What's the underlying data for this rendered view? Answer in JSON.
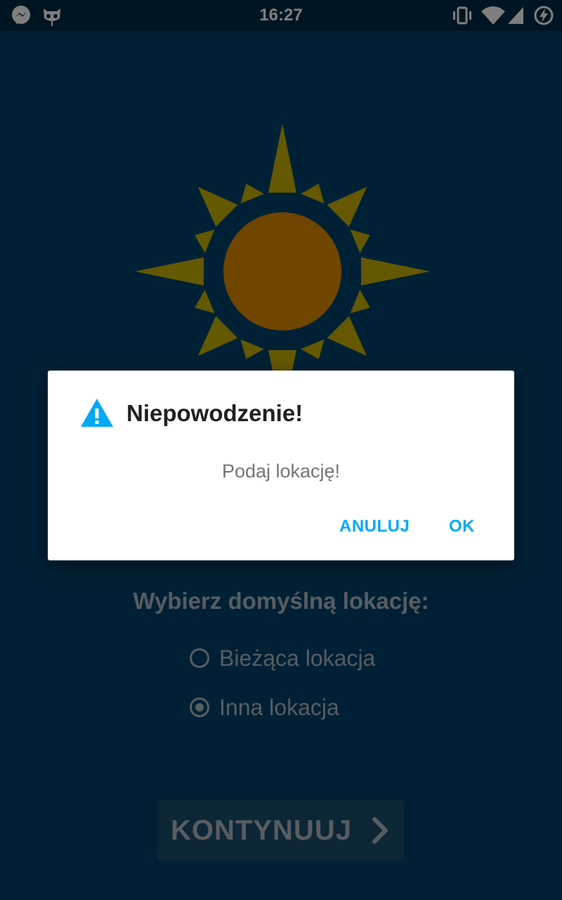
{
  "status_bar": {
    "time": "16:27",
    "left_icons": [
      "messenger-icon",
      "cyanogen-cat-icon"
    ],
    "right_icons": [
      "vibrate-icon",
      "wifi-icon",
      "signal-icon",
      "battery-charging-icon"
    ]
  },
  "main": {
    "logo": "sun-icon",
    "question": "Wybierz domyślną lokację:",
    "options": [
      {
        "label": "Bieżąca lokacja",
        "selected": false
      },
      {
        "label": "Inna lokacja",
        "selected": true
      }
    ],
    "continue_label": "KONTYNUUJ"
  },
  "dialog": {
    "icon": "warning-icon",
    "title": "Niepowodzenie!",
    "message": "Podaj lokację!",
    "cancel_label": "ANULUJ",
    "ok_label": "OK"
  },
  "colors": {
    "background": "#01426a",
    "status_bar": "#012a44",
    "accent": "#03a9f4",
    "sun_rays": "#c9b106",
    "sun_core": "#e08a00"
  }
}
